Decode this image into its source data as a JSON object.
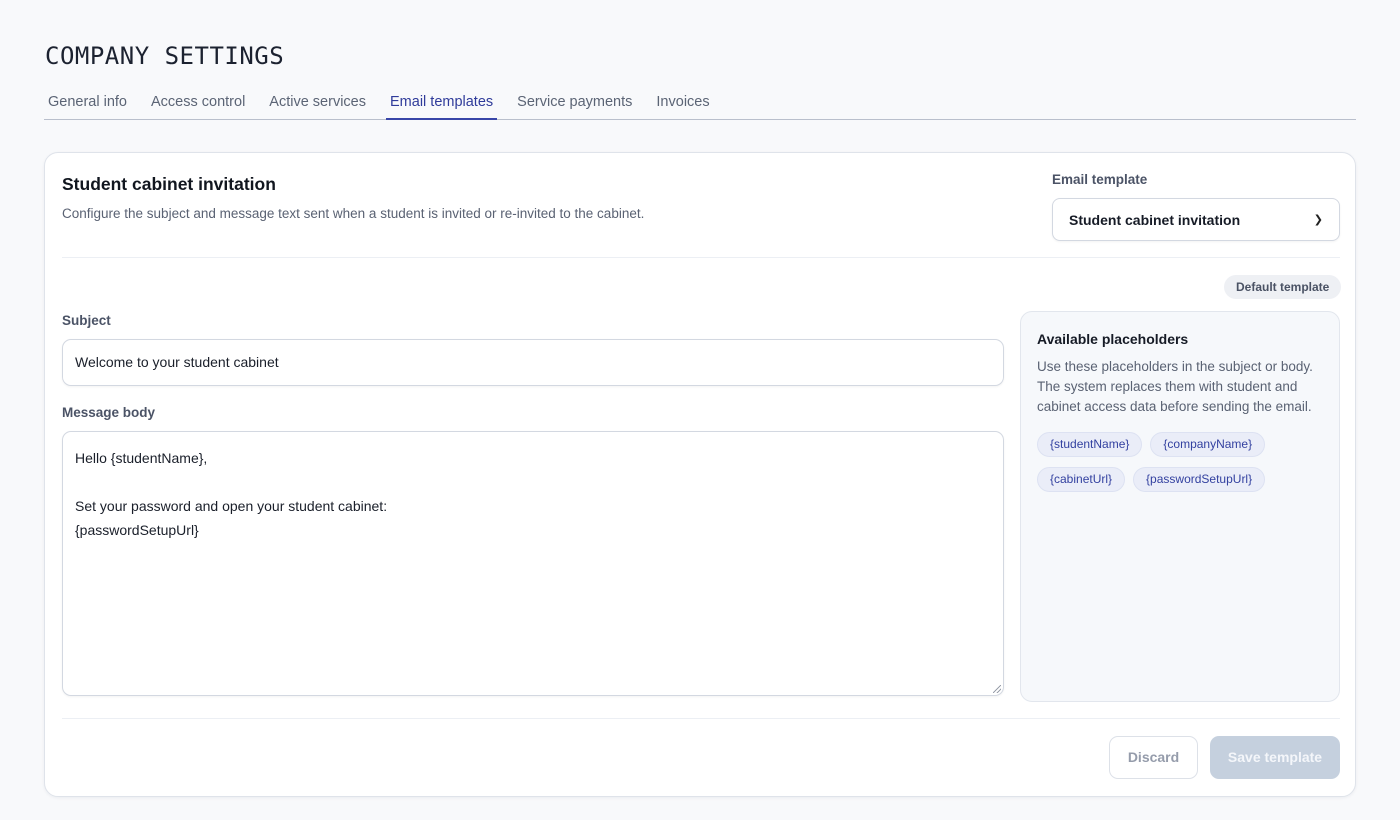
{
  "page": {
    "title": "COMPANY SETTINGS"
  },
  "tabs": [
    {
      "label": "General info",
      "active": false
    },
    {
      "label": "Access control",
      "active": false
    },
    {
      "label": "Active services",
      "active": false
    },
    {
      "label": "Email templates",
      "active": true
    },
    {
      "label": "Service payments",
      "active": false
    },
    {
      "label": "Invoices",
      "active": false
    }
  ],
  "card": {
    "title": "Student cabinet invitation",
    "description": "Configure the subject and message text sent when a student is invited or re-invited to the cabinet.",
    "template_select": {
      "label": "Email template",
      "value": "Student cabinet invitation"
    },
    "badge": "Default template",
    "subject": {
      "label": "Subject",
      "value": "Welcome to your student cabinet"
    },
    "body": {
      "label": "Message body",
      "lines": [
        "Hello {studentName},",
        "",
        "Set your password and open your student cabinet:",
        "{passwordSetupUrl}"
      ]
    },
    "placeholders": {
      "title": "Available placeholders",
      "description": "Use these placeholders in the subject or body. The system replaces them with student and cabinet access data before sending the email.",
      "items": [
        "{studentName}",
        "{companyName}",
        "{cabinetUrl}",
        "{passwordSetupUrl}"
      ]
    },
    "actions": {
      "discard": "Discard",
      "save": "Save template"
    }
  },
  "colors": {
    "accent": "#3845a8",
    "save_disabled": "#c5d0de",
    "chip_bg": "#eaedf8"
  }
}
